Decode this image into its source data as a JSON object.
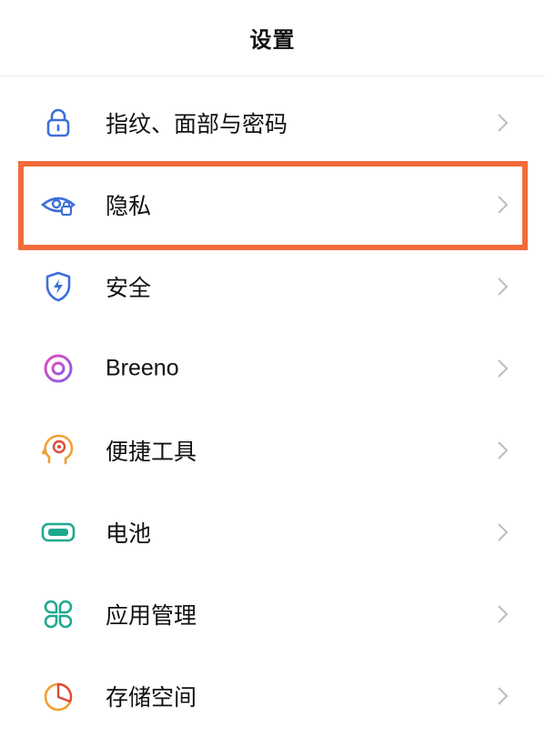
{
  "header": {
    "title": "设置"
  },
  "items": [
    {
      "label": "指纹、面部与密码",
      "icon": "lock-icon",
      "color": "#3d6fd9"
    },
    {
      "label": "隐私",
      "icon": "privacy-eye-lock-icon",
      "color": "#3d6fd9"
    },
    {
      "label": "安全",
      "icon": "security-shield-icon",
      "color": "#3d6fd9"
    },
    {
      "label": "Breeno",
      "icon": "breeno-ring-icon",
      "color": "#c04bd6"
    },
    {
      "label": "便捷工具",
      "icon": "head-target-icon",
      "color": "#f0a030"
    },
    {
      "label": "电池",
      "icon": "battery-icon",
      "color": "#1ea98f"
    },
    {
      "label": "应用管理",
      "icon": "apps-grid-icon",
      "color": "#1ea98f"
    },
    {
      "label": "存储空间",
      "icon": "storage-pie-icon",
      "color": "#f0a030"
    }
  ],
  "highlight": {
    "item": "隐私",
    "color": "#f26b3a"
  }
}
